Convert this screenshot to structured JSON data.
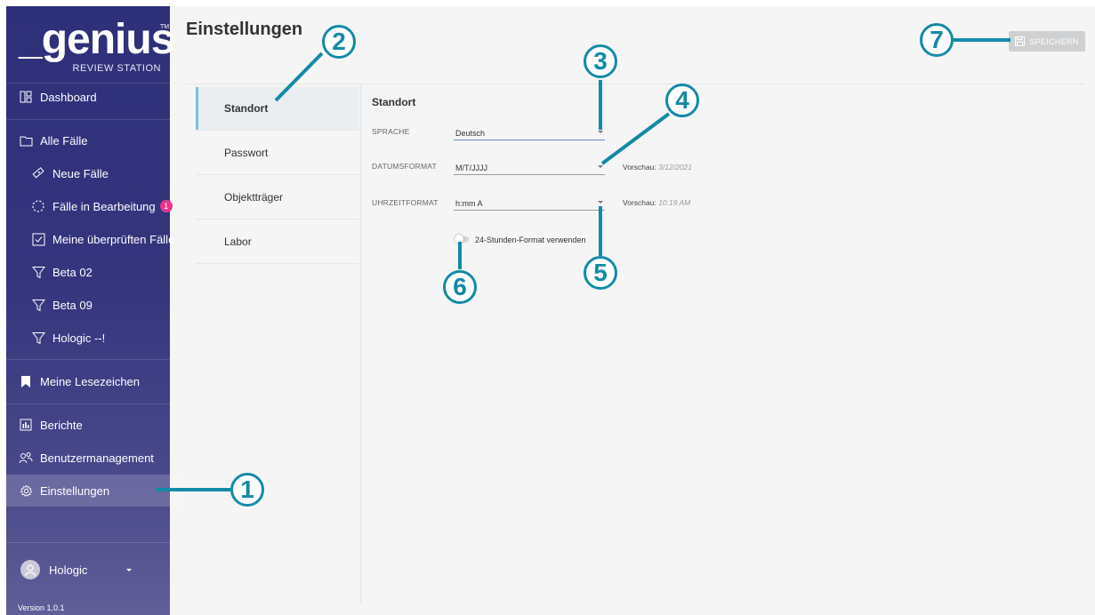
{
  "app": {
    "logo_text": "_genius",
    "logo_tm": "TM",
    "logo_subtitle": "REVIEW STATION"
  },
  "sidebar": {
    "dashboard": "Dashboard",
    "all_cases": "Alle Fälle",
    "new_cases": "Neue Fälle",
    "in_progress": "Fälle in Bearbeitung",
    "in_progress_count": "1",
    "my_reviewed": "Meine überprüften Fälle",
    "beta02": "Beta 02",
    "beta09": "Beta 09",
    "hologic_filter": "Hologic --!",
    "bookmarks": "Meine Lesezeichen",
    "reports": "Berichte",
    "user_mgmt": "Benutzermanagement",
    "settings": "Einstellungen",
    "user_name": "Hologic",
    "version": "Version 1.0.1"
  },
  "header": {
    "title": "Einstellungen",
    "save_label": "SPEICHERN"
  },
  "settings_menu": {
    "items": [
      "Standort",
      "Passwort",
      "Objektträger",
      "Labor"
    ]
  },
  "form": {
    "section_title": "Standort",
    "language_label": "SPRACHE",
    "language_value": "Deutsch",
    "date_label": "DATUMSFORMAT",
    "date_value": "M/T/JJJJ",
    "date_preview_label": "Vorschau:",
    "date_preview_value": "3/12/2021",
    "time_label": "UHRZEITFORMAT",
    "time_value": "h:mm A",
    "time_preview_label": "Vorschau:",
    "time_preview_value": "10:19 AM",
    "toggle_label": "24-Stunden-Format verwenden",
    "toggle_on": false
  },
  "callouts": [
    "1",
    "2",
    "3",
    "4",
    "5",
    "6",
    "7"
  ],
  "colors": {
    "sidebar": "#2e2f7a",
    "callout": "#138aa6",
    "badge": "#e8358a",
    "selected_bar": "#7cc0dd"
  }
}
